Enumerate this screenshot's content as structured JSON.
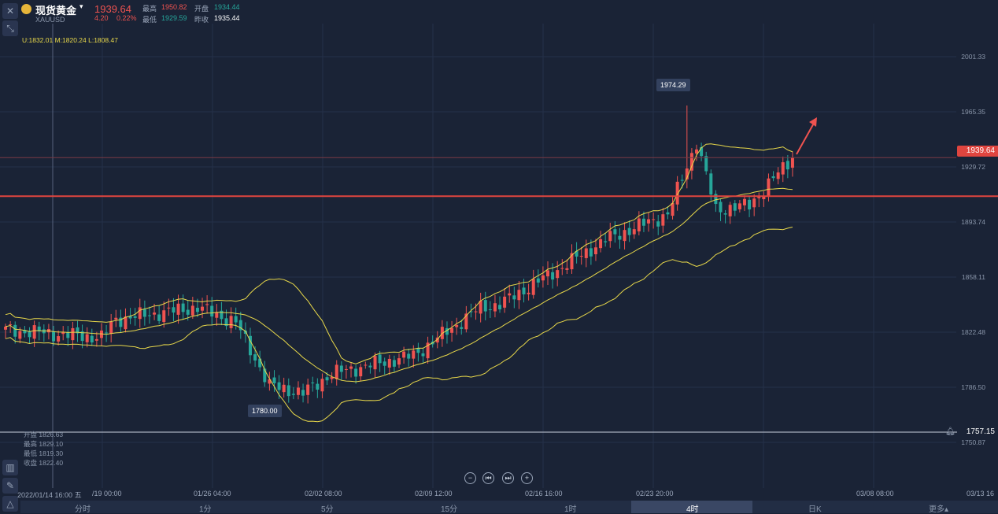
{
  "header": {
    "symbol_name": "现货黄金",
    "symbol_code": "XAUUSD",
    "price": "1939.64",
    "change": "4.20",
    "change_pct": "0.22%",
    "high_label": "最高",
    "high_value": "1950.82",
    "open_label": "开盘",
    "open_value": "1934.44",
    "low_label": "最低",
    "low_value": "1929.59",
    "prev_label": "昨收",
    "prev_value": "1935.44"
  },
  "bollinger": "U:1832.01  M:1820.24  L:1808.47",
  "cursor_ohlc": [
    "开盘 1826.63",
    "最高 1829.10",
    "最低 1819.30",
    "收盘 1822.40"
  ],
  "price_tag": "1939.64",
  "low_line_tag": "1757.15",
  "y_ticks": [
    "2001.33",
    "1965.35",
    "1929.72",
    "1893.74",
    "1858.11",
    "1822.48",
    "1786.50",
    "1750.87"
  ],
  "x_ticks": [
    "2022/01/14 16:00 五",
    "/19 00:00",
    "01/26 04:00",
    "02/02 08:00",
    "02/09 12:00",
    "02/16 16:00",
    "02/23 20:00",
    "03/08 08:00",
    "03/13 16"
  ],
  "callouts": {
    "high": "1974.29",
    "low": "1780.00"
  },
  "timeframes": [
    "分时",
    "1分",
    "5分",
    "15分",
    "1时",
    "4时",
    "日K",
    "更多▴"
  ],
  "active_timeframe": "4时",
  "nav_buttons": [
    "−",
    "⏮",
    "⏭",
    "+"
  ],
  "colors": {
    "background": "#1a2336",
    "up": "#ef5350",
    "down": "#26a69a",
    "bollinger": "#e8d84a",
    "resistance_line": "#e0453f"
  },
  "chart_data": {
    "type": "candlestick",
    "ylim": [
      1745,
      2012
    ],
    "candles_count": 165,
    "key_points": [
      {
        "i": 0,
        "close": 1825
      },
      {
        "i": 20,
        "close": 1820
      },
      {
        "i": 23,
        "close": 1832
      },
      {
        "i": 40,
        "close": 1840
      },
      {
        "i": 48,
        "close": 1830
      },
      {
        "i": 55,
        "close": 1788
      },
      {
        "i": 62,
        "close": 1783
      },
      {
        "i": 68,
        "close": 1796
      },
      {
        "i": 85,
        "close": 1808
      },
      {
        "i": 99,
        "close": 1840
      },
      {
        "i": 103,
        "close": 1842
      },
      {
        "i": 115,
        "close": 1865
      },
      {
        "i": 125,
        "close": 1885
      },
      {
        "i": 138,
        "close": 1902
      },
      {
        "i": 144,
        "close": 1950
      },
      {
        "i": 148,
        "close": 1905
      },
      {
        "i": 155,
        "close": 1908
      },
      {
        "i": 164,
        "close": 1939.64
      }
    ],
    "high_point": 1974.29,
    "low_point": 1780.0,
    "resistance_level": 1914,
    "current_level": 1939.64
  }
}
